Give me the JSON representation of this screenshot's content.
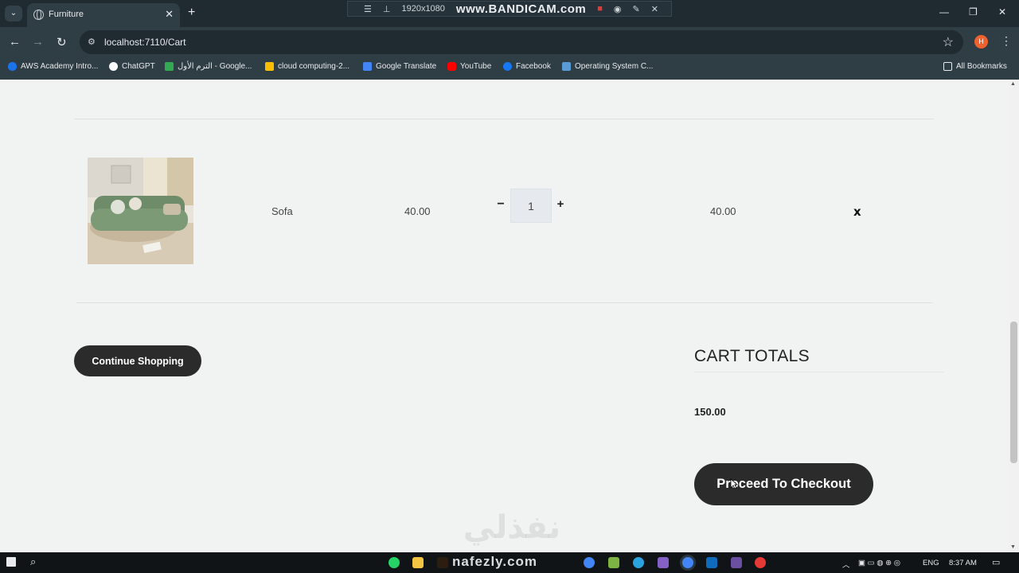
{
  "browser": {
    "tab_title": "Furniture",
    "url": "localhost:7110/Cart",
    "profile_initial": "H",
    "bookmarks": [
      {
        "label": "AWS Academy Intro...",
        "color": "#1a73e8"
      },
      {
        "label": "ChatGPT",
        "color": "#ffffff"
      },
      {
        "label": "الترم الأول - Google...",
        "color": "#34a853"
      },
      {
        "label": "cloud computing-2...",
        "color": "#fbbc04"
      },
      {
        "label": "Google Translate",
        "color": "#4285f4"
      },
      {
        "label": "YouTube",
        "color": "#ff0000"
      },
      {
        "label": "Facebook",
        "color": "#1877f2"
      },
      {
        "label": "Operating System C...",
        "color": "#5a9bd5"
      }
    ],
    "all_bookmarks": "All Bookmarks"
  },
  "recorder": {
    "resolution": "1920x1080",
    "brand": "www.BANDICAM.com"
  },
  "cart": {
    "item": {
      "name": "Sofa",
      "price": "40.00",
      "quantity": "1",
      "subtotal": "40.00",
      "remove_label": "x"
    },
    "continue_label": "Continue Shopping",
    "totals_title": "CART TOTALS",
    "total_value": "150.00",
    "checkout_label": "Proceed To Checkout"
  },
  "watermark": {
    "arabic": "نفذلي",
    "latin": "nafezly.com"
  },
  "taskbar": {
    "language": "ENG",
    "time": "8:37 AM"
  },
  "colors": {
    "page_bg": "#f1f2f2",
    "button_dark": "#2b2b2b",
    "chrome_dark": "#2f3d45"
  }
}
